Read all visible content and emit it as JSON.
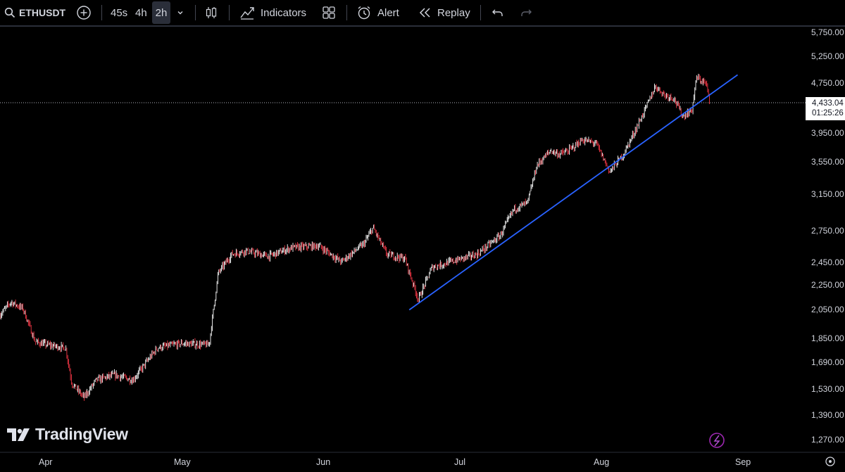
{
  "toolbar": {
    "symbol": "ETHUSDT",
    "intervals": [
      "45s",
      "4h",
      "2h"
    ],
    "active_interval": "2h",
    "indicators_label": "Indicators",
    "alert_label": "Alert",
    "replay_label": "Replay",
    "icons": [
      "search-icon",
      "add-symbol-icon",
      "interval-dropdown-icon",
      "candles-icon",
      "indicators-icon",
      "templates-icon",
      "alert-icon",
      "replay-icon",
      "undo-icon",
      "redo-icon"
    ]
  },
  "chart": {
    "price_axis_labels": [
      "5,750.00",
      "5,250.00",
      "4,750.00",
      "3,950.00",
      "3,550.00",
      "3,150.00",
      "2,750.00",
      "2,450.00",
      "2,250.00",
      "2,050.00",
      "1,850.00",
      "1,690.00",
      "1,530.00",
      "1,390.00",
      "1,270.00"
    ],
    "time_axis_labels": [
      "Apr",
      "May",
      "Jun",
      "Jul",
      "Aug",
      "Sep"
    ],
    "last_price": "4,433.04",
    "countdown": "01:25:26",
    "trendline_color": "#2962ff",
    "candle_up_color": "#ffffff",
    "candle_down_color": "#f23645",
    "logo_text": "TradingView"
  },
  "chart_data": {
    "type": "candlestick",
    "symbol": "ETHUSDT",
    "interval": "2h",
    "y_scale": "log",
    "ylim": [
      1200,
      5900
    ],
    "x_ticks": [
      "Apr",
      "May",
      "Jun",
      "Jul",
      "Aug",
      "Sep"
    ],
    "last_price": 4433.04,
    "close_path": [
      {
        "x": "Apr 1",
        "y": 2000
      },
      {
        "x": "Apr 3",
        "y": 2110
      },
      {
        "x": "Apr 5",
        "y": 2060
      },
      {
        "x": "Apr 7",
        "y": 1820
      },
      {
        "x": "Apr 9",
        "y": 1800
      },
      {
        "x": "Apr 12",
        "y": 1780
      },
      {
        "x": "Apr 13",
        "y": 1560
      },
      {
        "x": "Apr 15",
        "y": 1480
      },
      {
        "x": "Apr 17",
        "y": 1580
      },
      {
        "x": "Apr 20",
        "y": 1610
      },
      {
        "x": "Apr 23",
        "y": 1580
      },
      {
        "x": "Apr 27",
        "y": 1780
      },
      {
        "x": "May 1",
        "y": 1810
      },
      {
        "x": "May 7",
        "y": 1800
      },
      {
        "x": "May 9",
        "y": 2350
      },
      {
        "x": "May 12",
        "y": 2520
      },
      {
        "x": "May 15",
        "y": 2550
      },
      {
        "x": "May 20",
        "y": 2500
      },
      {
        "x": "May 25",
        "y": 2580
      },
      {
        "x": "May 31",
        "y": 2600
      },
      {
        "x": "Jun 5",
        "y": 2450
      },
      {
        "x": "Jun 10",
        "y": 2620
      },
      {
        "x": "Jun 12",
        "y": 2780
      },
      {
        "x": "Jun 15",
        "y": 2520
      },
      {
        "x": "Jun 19",
        "y": 2480
      },
      {
        "x": "Jun 22",
        "y": 2130
      },
      {
        "x": "Jun 25",
        "y": 2400
      },
      {
        "x": "Jun 30",
        "y": 2460
      },
      {
        "x": "Jul 5",
        "y": 2520
      },
      {
        "x": "Jul 10",
        "y": 2700
      },
      {
        "x": "Jul 13",
        "y": 2980
      },
      {
        "x": "Jul 16",
        "y": 3050
      },
      {
        "x": "Jul 18",
        "y": 3500
      },
      {
        "x": "Jul 21",
        "y": 3700
      },
      {
        "x": "Jul 23",
        "y": 3650
      },
      {
        "x": "Jul 25",
        "y": 3700
      },
      {
        "x": "Jul 28",
        "y": 3850
      },
      {
        "x": "Jul 31",
        "y": 3800
      },
      {
        "x": "Aug 3",
        "y": 3420
      },
      {
        "x": "Aug 6",
        "y": 3650
      },
      {
        "x": "Aug 9",
        "y": 4050
      },
      {
        "x": "Aug 11",
        "y": 4350
      },
      {
        "x": "Aug 13",
        "y": 4700
      },
      {
        "x": "Aug 15",
        "y": 4550
      },
      {
        "x": "Aug 17",
        "y": 4500
      },
      {
        "x": "Aug 19",
        "y": 4200
      },
      {
        "x": "Aug 21",
        "y": 4300
      },
      {
        "x": "Aug 22",
        "y": 4850
      },
      {
        "x": "Aug 24",
        "y": 4750
      },
      {
        "x": "Aug 25",
        "y": 4433
      }
    ],
    "trendline": {
      "start": {
        "x": "Jun 20",
        "y": 2050
      },
      "end": {
        "x": "Aug 31",
        "y": 4900
      }
    }
  }
}
